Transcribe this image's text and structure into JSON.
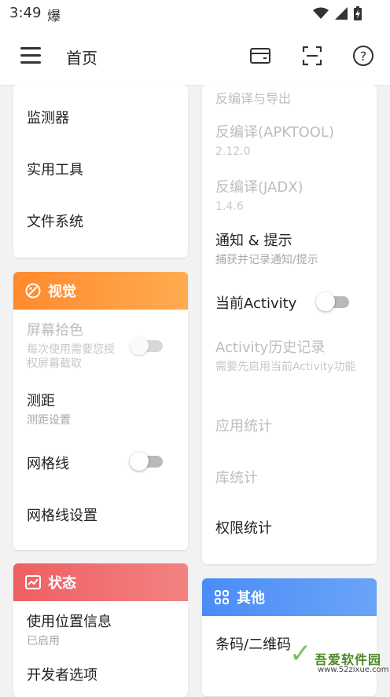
{
  "status_bar": {
    "time": "3:49",
    "extra_glyph": "爆",
    "icons": [
      "wifi-icon",
      "signal-icon",
      "battery-icon"
    ]
  },
  "app_bar": {
    "title": "首页",
    "icons": [
      "menu-icon",
      "card-icon",
      "scan-icon",
      "help-icon"
    ]
  },
  "colors": {
    "visual_header": "#ff9b3d",
    "status_header": "#f06a6a",
    "other_header": "#4f8ff7"
  },
  "left": {
    "tools_card": {
      "items": [
        "监测器",
        "实用工具",
        "文件系统"
      ]
    },
    "visual_card": {
      "title": "视觉",
      "items": [
        {
          "title": "屏幕拾色",
          "subtitle": "每次使用需要您授权屏幕截取",
          "toggle": false,
          "enabled": false
        },
        {
          "title": "测距",
          "subtitle": "测距设置"
        },
        {
          "title": "网格线",
          "toggle": false
        },
        {
          "title": "网格线设置"
        }
      ]
    },
    "status_card": {
      "title": "状态",
      "items": [
        {
          "title": "使用位置信息",
          "subtitle": "已启用"
        },
        {
          "title": "开发者选项"
        }
      ]
    }
  },
  "right": {
    "tools_card": {
      "items": [
        {
          "title": "反编译与导出",
          "enabled": false
        },
        {
          "title": "反编译(APKTOOL)",
          "subtitle": "2.12.0",
          "enabled": false
        },
        {
          "title": "反编译(JADX)",
          "subtitle": "1.4.6",
          "enabled": false
        },
        {
          "title": "通知 & 提示",
          "subtitle": "捕获并记录通知/提示"
        },
        {
          "title": "当前Activity",
          "toggle": false
        },
        {
          "title": "Activity历史记录",
          "subtitle": "需要先启用当前Activity功能",
          "enabled": false
        },
        {
          "title": "应用统计",
          "enabled": false
        },
        {
          "title": "库统计",
          "enabled": false
        },
        {
          "title": "权限统计"
        }
      ]
    },
    "other_card": {
      "title": "其他",
      "items": [
        "条码/二维码"
      ]
    }
  },
  "watermark": {
    "name": "吾爱软件园",
    "url": "www.52zixue.com"
  }
}
